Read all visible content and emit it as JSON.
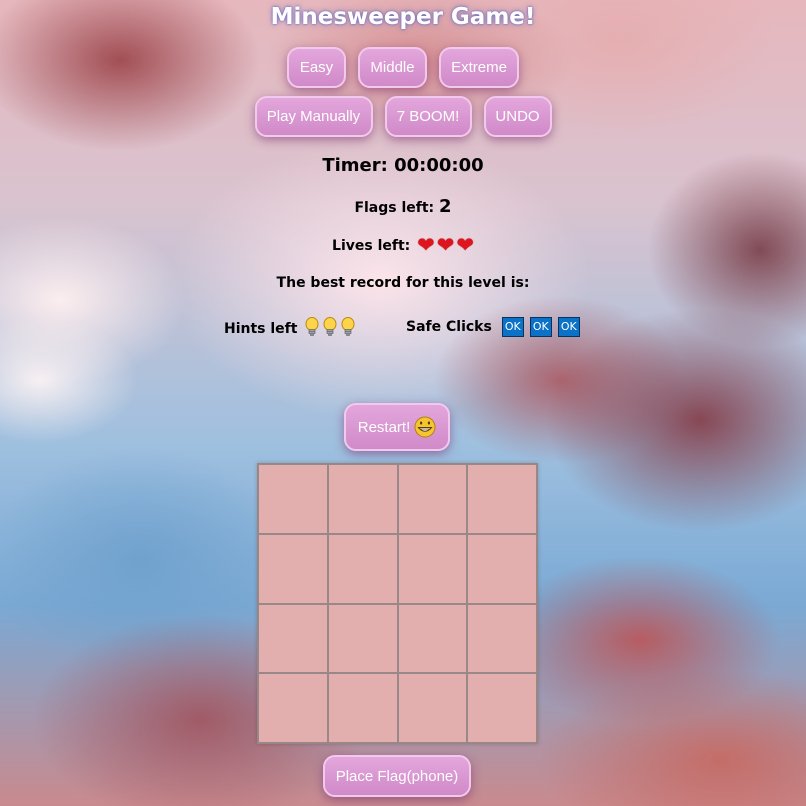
{
  "title": "Minesweeper Game!",
  "levels": {
    "easy": "Easy",
    "middle": "Middle",
    "extreme": "Extreme"
  },
  "modes": {
    "play_manually": "Play Manually",
    "seven_boom": "7 BOOM!",
    "undo": "UNDO"
  },
  "timer": {
    "label": "Timer:",
    "value": "00:00:00"
  },
  "flags": {
    "label": "Flags left:",
    "count": "2"
  },
  "lives": {
    "label": "Lives left:",
    "count": 3,
    "icon": "heart-icon"
  },
  "record": {
    "label": "The best record for this level is:"
  },
  "hints": {
    "label": "Hints left",
    "count": 3,
    "icon": "lightbulb-icon"
  },
  "safe_clicks": {
    "label": "Safe Clicks",
    "count": 3,
    "icon_text": "OK"
  },
  "restart": {
    "label": "Restart!",
    "icon": "grinning-face-icon"
  },
  "board": {
    "rows": 4,
    "cols": 4,
    "cell_color": "#e2aeae"
  },
  "place_flag": {
    "label": "Place Flag(phone)"
  },
  "colors": {
    "button_fill": "#d89ad0",
    "heart": "#e0141e",
    "ok_box": "#0c72c8"
  }
}
